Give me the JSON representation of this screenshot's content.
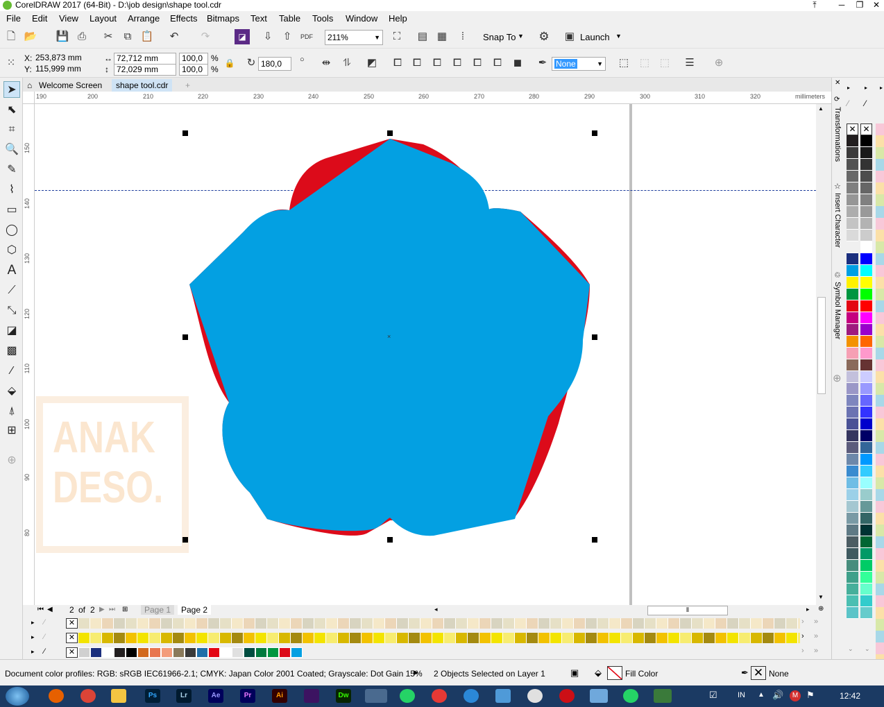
{
  "app": {
    "title": "CorelDRAW 2017 (64-Bit) - D:\\job design\\shape tool.cdr"
  },
  "menu": [
    "File",
    "Edit",
    "View",
    "Layout",
    "Arrange",
    "Effects",
    "Bitmaps",
    "Text",
    "Table",
    "Tools",
    "Window",
    "Help"
  ],
  "toolbar": {
    "zoom": "211%",
    "snap_to": "Snap To",
    "launch": "Launch"
  },
  "properties": {
    "x": "253,873 mm",
    "y": "115,999 mm",
    "width": "72,712 mm",
    "height": "72,029 mm",
    "scale_x": "100,0",
    "scale_y": "100,0",
    "percent": "%",
    "rotation": "180,0",
    "outline": "None"
  },
  "tabs": {
    "welcome": "Welcome Screen",
    "active": "shape tool.cdr"
  },
  "ruler": {
    "unit": "millimeters",
    "h_ticks": [
      "190",
      "200",
      "210",
      "220",
      "230",
      "240",
      "250",
      "260",
      "270",
      "280",
      "290",
      "300",
      "310",
      "320"
    ],
    "v_ticks": [
      "150",
      "140",
      "130",
      "120",
      "110",
      "100",
      "90",
      "80"
    ]
  },
  "dockers": [
    "Transformations",
    "Insert Character",
    "Symbol Manager"
  ],
  "page_nav": {
    "current": "2",
    "of": "of",
    "total": "2",
    "page1": "Page 1",
    "page2": "Page 2"
  },
  "watermark": {
    "line1": "ANAK",
    "line2": "DESO."
  },
  "status": {
    "profiles": "Document color profiles: RGB: sRGB IEC61966-2.1; CMYK: Japan Color 2001 Coated; Grayscale: Dot Gain 15%",
    "selection": "2 Objects Selected on Layer 1",
    "fill": "Fill Color",
    "outline": "None"
  },
  "taskbar": {
    "lang": "IN",
    "time": "12:42",
    "apps": [
      "Ps",
      "Lr",
      "Ae",
      "Pr",
      "Ai",
      "Dw"
    ]
  },
  "colors": {
    "shape_front": "#03a0e2",
    "shape_back": "#dc0b1a",
    "taskbar": "#1b3a63"
  }
}
